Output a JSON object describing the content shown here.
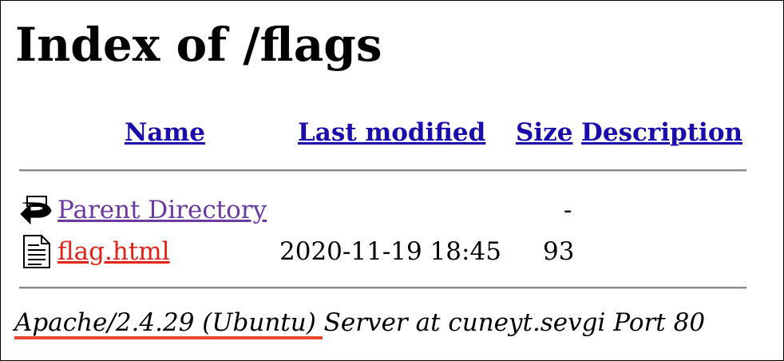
{
  "page": {
    "title": "Index of /flags"
  },
  "table": {
    "headers": {
      "name": "Name",
      "last_modified": "Last modified",
      "size": "Size",
      "description": "Description"
    },
    "rows": [
      {
        "icon": "parent-directory-icon",
        "name": "Parent Directory",
        "last_modified": "",
        "size": "-",
        "description": ""
      },
      {
        "icon": "text-file-icon",
        "name": "flag.html",
        "last_modified": "2020-11-19 18:45",
        "size": "93",
        "description": ""
      }
    ]
  },
  "footer": {
    "server_signature": "Apache/2.4.29 (Ubuntu) Server at cuneyt.sevgi Port 80"
  },
  "colors": {
    "header_link": "#1a0dab",
    "visited_link": "#6a3aa0",
    "active_link": "#e0231b",
    "annotation_underline": "#e64a2e"
  }
}
